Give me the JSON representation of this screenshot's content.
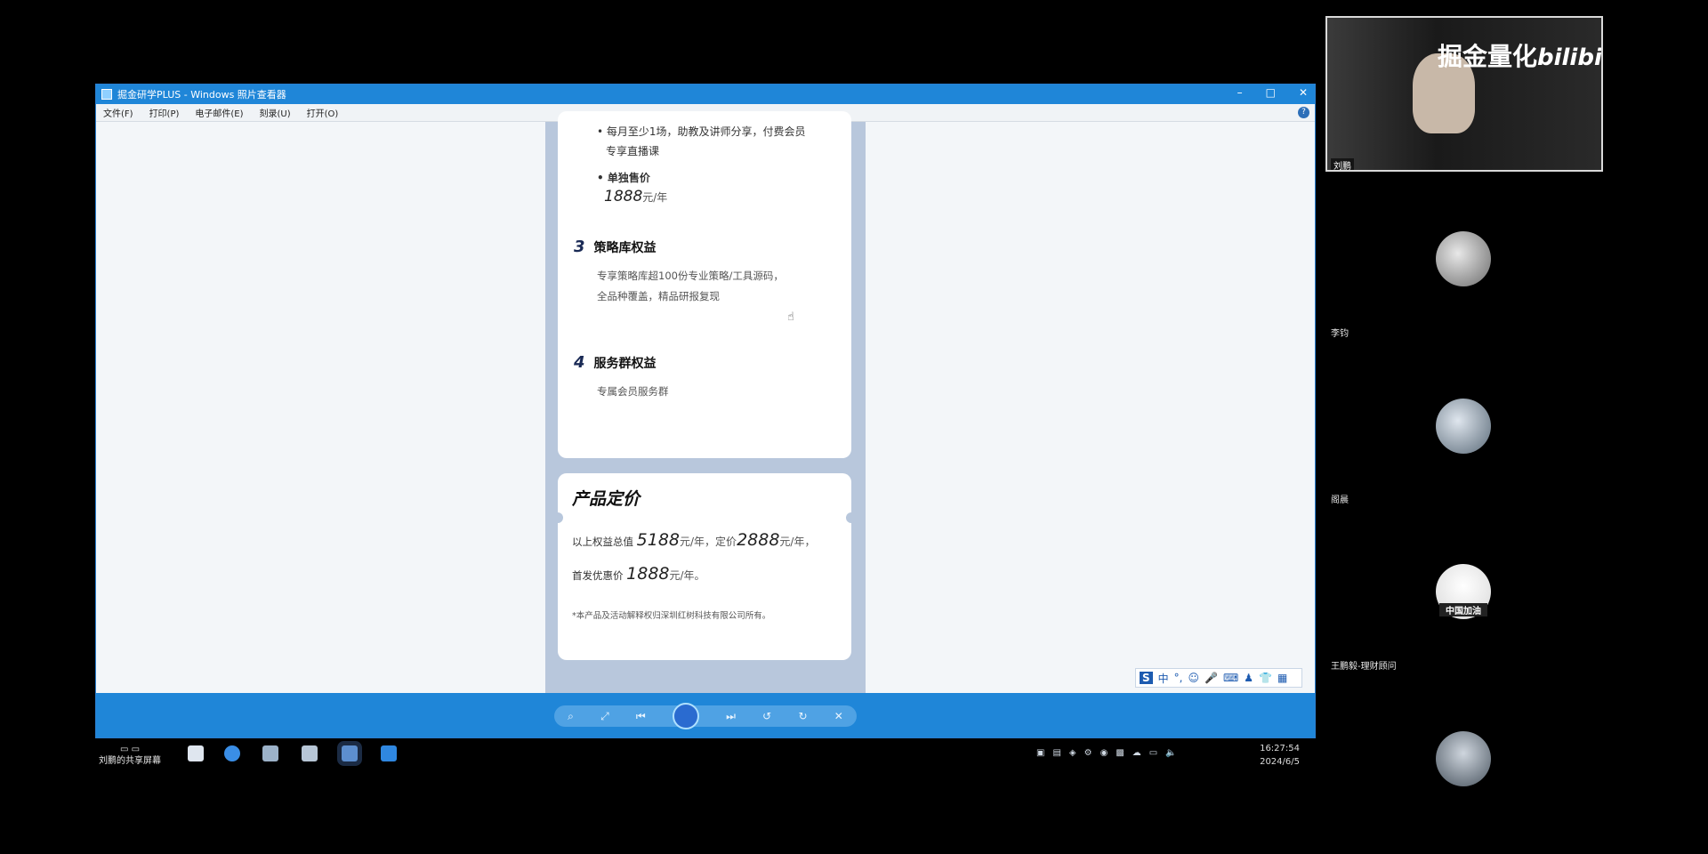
{
  "window": {
    "title": "掘金研学PLUS - Windows 照片查看器",
    "controls": [
      "–",
      "□",
      "✕"
    ]
  },
  "menu": {
    "items": [
      "文件(F)",
      "打印(P)",
      "电子邮件(E)",
      "刻录(U)",
      "打开(O)"
    ],
    "help": "?"
  },
  "document": {
    "bullet1": "• 每月至少1场，助教及讲师分享，付费会员",
    "bullet1_cont": "专享直播课",
    "single_price_label": "• 单独售价",
    "single_price_value": "1888",
    "single_price_unit": "元/年",
    "section3_num": "3",
    "section3_title": "策略库权益",
    "section3_line1": "专享策略库超100份专业策略/工具源码，",
    "section3_line2": "全品种覆盖，精品研报复现",
    "section4_num": "4",
    "section4_title": "服务群权益",
    "section4_line1": "专属会员服务群",
    "pricing_title": "产品定价",
    "pricing_line1_a": "以上权益总值",
    "pricing_total": "5188",
    "pricing_unit1": "元/年，定价",
    "pricing_list": "2888",
    "pricing_unit2": "元/年，",
    "pricing_line2_a": "首发优惠价",
    "pricing_promo": "1888",
    "pricing_unit3": "元/年。",
    "footnote": "*本产品及活动解释权归深圳红树科技有限公司所有。"
  },
  "ime": {
    "label": "S",
    "mode": "中"
  },
  "taskbar": {
    "share_label": "刘鹏的共享屏幕",
    "time": "16:27:54",
    "date": "2024/6/5"
  },
  "panel": {
    "watermark": "掘金量化",
    "watermark_logo": "bilibili",
    "camera_name": "刘鹏",
    "participants": [
      {
        "name": "李钧"
      },
      {
        "name": "阁晨"
      },
      {
        "name": "王鹏毅-理财顾问",
        "badge": "中国加油"
      },
      {
        "name": ""
      }
    ]
  },
  "colors": {
    "accent": "#1f86d8",
    "doc_bg": "#b8c7dc",
    "card": "#ffffff"
  }
}
